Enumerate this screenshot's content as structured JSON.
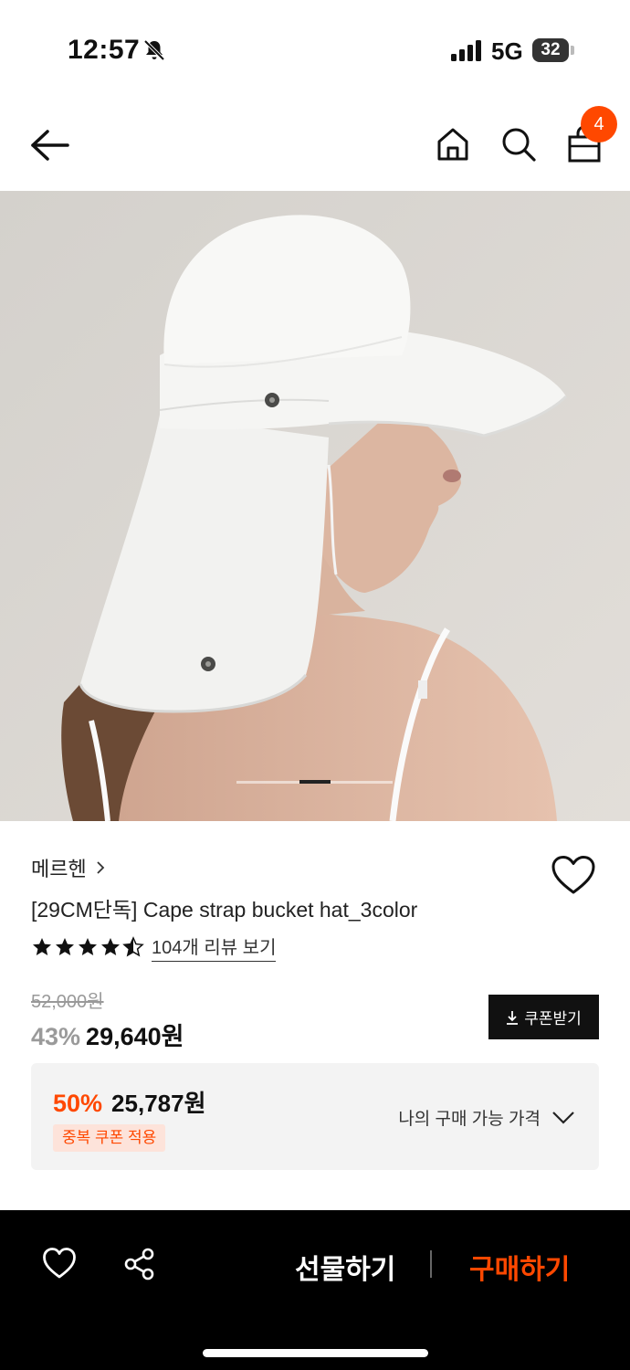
{
  "status_bar": {
    "time": "12:57",
    "network": "5G",
    "battery": "32"
  },
  "header": {
    "cart_count": "4"
  },
  "carousel": {
    "current_slide": 3,
    "total_slides": 5
  },
  "product": {
    "brand": "메르헨",
    "title": "[29CM단독] Cape strap bucket hat_3color",
    "rating": 4.5,
    "review_link": "104개 리뷰 보기",
    "original_price": "52,000원",
    "discount_rate": "43%",
    "price": "29,640원",
    "coupon_button": "쿠폰받기"
  },
  "my_price": {
    "discount_rate": "50%",
    "price": "25,787원",
    "tag": "중복 쿠폰 적용",
    "expand_label": "나의 구매 가능 가격"
  },
  "bottom_bar": {
    "gift_label": "선물하기",
    "buy_label": "구매하기"
  },
  "colors": {
    "accent": "#ff4800",
    "dark": "#111111",
    "panel": "#f3f3f3"
  }
}
